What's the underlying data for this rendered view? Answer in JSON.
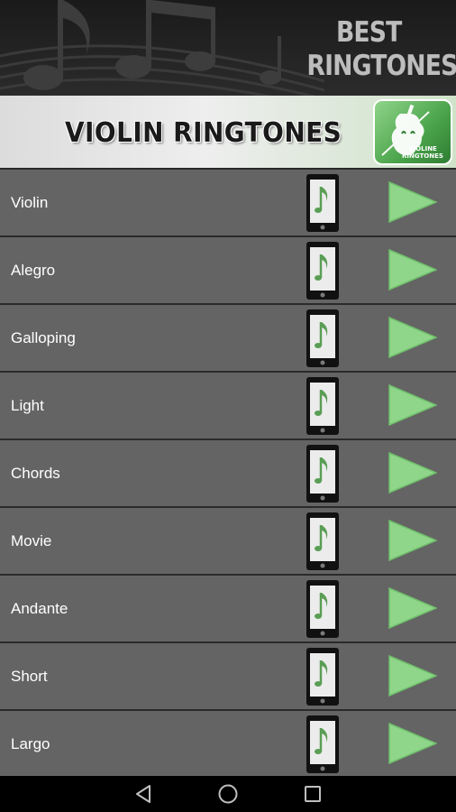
{
  "brand": {
    "line1": "BEST",
    "line2": "RINGTONES"
  },
  "header": {
    "title": "VIOLIN RINGTONES",
    "app_icon_label_line1": "VIOLINE",
    "app_icon_label_line2": "RINGTONES"
  },
  "ringtones": [
    {
      "name": "Violin"
    },
    {
      "name": "Alegro"
    },
    {
      "name": "Galloping"
    },
    {
      "name": "Light"
    },
    {
      "name": "Chords"
    },
    {
      "name": "Movie"
    },
    {
      "name": "Andante"
    },
    {
      "name": "Short"
    },
    {
      "name": "Largo"
    }
  ],
  "icons": {
    "row_set_ringtone": "phone-music-icon",
    "row_play": "play-icon",
    "nav_back": "back-triangle-icon",
    "nav_home": "home-circle-icon",
    "nav_recents": "recents-square-icon"
  },
  "colors": {
    "row_background": "#646464",
    "row_separator": "#2a2a2a",
    "play_green": "#8fd68a",
    "note_green": "#5a9e55",
    "header_text": "#1a1a1a",
    "brand_text": "#bdbdbd"
  }
}
